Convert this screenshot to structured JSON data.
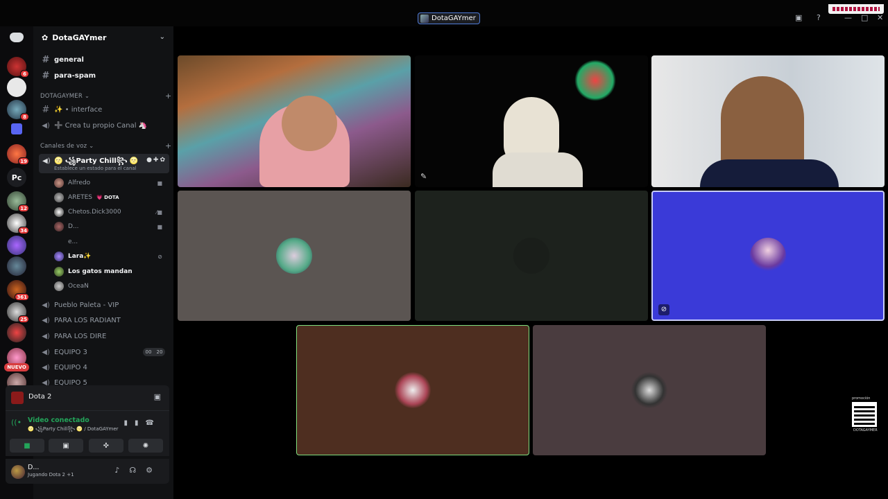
{
  "window": {
    "title": "DotaGAYmer"
  },
  "servers": {
    "badges": [
      "6",
      "8",
      "19",
      "12",
      "34",
      "361",
      "25"
    ],
    "text_server": "Pc",
    "nuevo_label": "NUEVO"
  },
  "guild": {
    "name": "DotaGAYmer",
    "channels_top": [
      {
        "name": "general"
      },
      {
        "name": "para-spam"
      }
    ],
    "category_1": "DOTAGAYMER",
    "category_1_channels": [
      {
        "name": "✨ • interface"
      },
      {
        "name": "➕ Crea tu propio Canal 🦄"
      }
    ],
    "category_2": "Canales de voz",
    "active_voice": {
      "name": "🌝 ꧁Party Chill꧂ 🌝",
      "sub": "Establece un estado para el canal"
    },
    "members": [
      {
        "name": "Alfredo"
      },
      {
        "name": "ARETES",
        "tag": "💗 DOTA"
      },
      {
        "name": "Chetos.Dick3000"
      },
      {
        "name": "D..."
      },
      {
        "name": "e..."
      },
      {
        "name": "Lara✨"
      },
      {
        "name": "Los gatos mandan"
      },
      {
        "name": "OceaN"
      }
    ],
    "voice_channels": [
      {
        "name": "Pueblo Paleta - VIP"
      },
      {
        "name": "PARA LOS RADIANT"
      },
      {
        "name": "PARA LOS DIRE"
      },
      {
        "name": "EQUIPO 3",
        "count_a": "00",
        "count_b": "20"
      },
      {
        "name": "EQUIPO 4"
      },
      {
        "name": "EQUIPO 5"
      }
    ]
  },
  "activity": {
    "game": "Dota 2"
  },
  "voice_panel": {
    "status": "Video conectado",
    "path": "🌝 ꧁Party Chill꧂ 🌝 / DotaGAYmer"
  },
  "user_panel": {
    "name": "D...",
    "activity": "Jugando Dota 2 +1"
  },
  "overlay": {
    "qr_top": "promoción",
    "qr_bottom": "DOTAGAYMER"
  },
  "colors": {
    "accent_green": "#23a55a",
    "speaking_blue": "#3a3ad8",
    "badge_red": "#e53838"
  }
}
